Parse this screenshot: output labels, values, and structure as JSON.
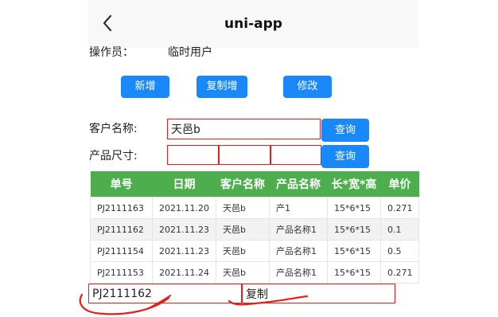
{
  "header": {
    "title": "uni-app",
    "back_icon": "chevron-left-icon"
  },
  "operator": {
    "label": "操作员：",
    "value": "临时用户"
  },
  "toolbar": {
    "add_label": "新增",
    "copy_add_label": "复制增",
    "edit_label": "修改"
  },
  "customer": {
    "label": "客户名称:",
    "value": "天邑b",
    "query_label": "查询"
  },
  "size": {
    "label": "产品尺寸:",
    "length": "",
    "width": "",
    "height": "",
    "query_label": "查询"
  },
  "table": {
    "headers": [
      "单号",
      "日期",
      "客户名称",
      "产品名称",
      "长*宽*高",
      "单价"
    ],
    "rows": [
      [
        "PJ2111163",
        "2021.11.20",
        "天邑b",
        "产1",
        "15*6*15",
        "0.271"
      ],
      [
        "PJ2111162",
        "2021.11.23",
        "天邑b",
        "产品名称1",
        "15*6*15",
        "0.1"
      ],
      [
        "PJ2111154",
        "2021.11.23",
        "天邑b",
        "产品名称1",
        "15*6*15",
        "0.5"
      ],
      [
        "PJ2111153",
        "2021.11.24",
        "天邑b",
        "产品名称1",
        "15*6*15",
        "0.271"
      ]
    ]
  },
  "selection": {
    "order_no": "PJ2111162",
    "action": "复制"
  },
  "colors": {
    "primary": "#1989fa",
    "table_header": "#4cae4c",
    "field_border": "#e02020",
    "annotation": "#e0201c"
  }
}
